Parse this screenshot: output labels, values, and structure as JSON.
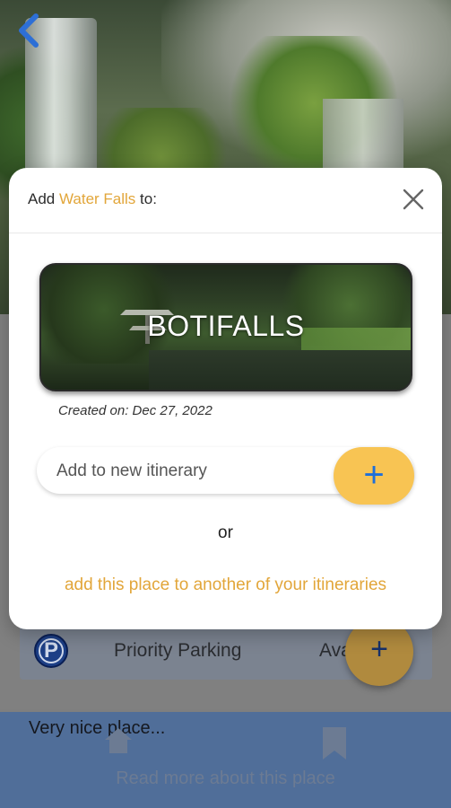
{
  "background": {
    "parking": {
      "label": "Priority Parking",
      "status": "Ava",
      "icon_letter": "P"
    },
    "fab_symbol": "+",
    "description": "Very nice place...",
    "read_more": "Read more about this place"
  },
  "modal": {
    "title_prefix": "Add ",
    "place_name": "Water Falls",
    "title_suffix": " to:",
    "itinerary_card": {
      "name": "BOTIFALLS",
      "created": "Created on: Dec 27, 2022"
    },
    "new_itinerary": {
      "placeholder": "Add to new itinerary",
      "button_symbol": "+"
    },
    "or_text": "or",
    "other_link": "add this place to another of your itineraries"
  },
  "colors": {
    "accent": "#e2a63a",
    "button_yellow": "#f8c453",
    "plus_blue": "#1e6fd9",
    "back_blue": "#2d6fd6"
  }
}
